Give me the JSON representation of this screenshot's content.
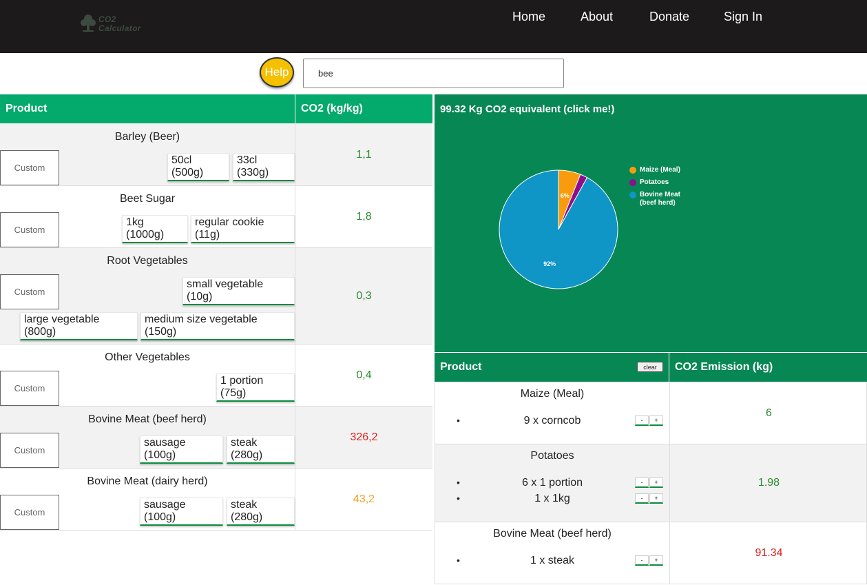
{
  "nav": {
    "logo_line1": "CO2",
    "logo_line2": "Calculator",
    "items": [
      "Home",
      "About",
      "Donate",
      "Sign In"
    ]
  },
  "help_label": "Help",
  "search": {
    "value": "bee"
  },
  "left_table": {
    "headers": {
      "product": "Product",
      "co2": "CO2 (kg/kg)"
    },
    "custom_placeholder": "Custom",
    "rows": [
      {
        "name": "Barley (Beer)",
        "co2": "1,1",
        "co2_color": "#2a8a2a",
        "buttons": [
          "50cl (500g)",
          "33cl (330g)"
        ]
      },
      {
        "name": "Beet Sugar",
        "co2": "1,8",
        "co2_color": "#2a8a2a",
        "buttons": [
          "1kg (1000g)",
          "regular cookie (11g)"
        ]
      },
      {
        "name": "Root Vegetables",
        "co2": "0,3",
        "co2_color": "#2a8a2a",
        "buttons": [
          "small vegetable (10g)",
          "large vegetable (800g)",
          "medium size vegetable (150g)"
        ]
      },
      {
        "name": "Other Vegetables",
        "co2": "0,4",
        "co2_color": "#2a8a2a",
        "buttons": [
          "1 portion (75g)"
        ]
      },
      {
        "name": "Bovine Meat (beef herd)",
        "co2": "326,2",
        "co2_color": "#e02020",
        "buttons": [
          "sausage (100g)",
          "steak (280g)"
        ]
      },
      {
        "name": "Bovine Meat (dairy herd)",
        "co2": "43,2",
        "co2_color": "#f0a020",
        "buttons": [
          "sausage (100g)",
          "steak (280g)"
        ]
      }
    ]
  },
  "chart": {
    "title": "99.32 Kg CO2 equivalent (click me!)"
  },
  "chart_data": {
    "type": "pie",
    "title": "",
    "legend_position": "right",
    "slices": [
      {
        "label": "Maize (Meal)",
        "value": 6,
        "color": "#f89c0e",
        "pct_label": "6%"
      },
      {
        "label": "Potatoes",
        "value": 1.98,
        "color": "#8e0e8e",
        "pct_label": ""
      },
      {
        "label": "Bovine Meat (beef herd)",
        "value": 91.34,
        "color": "#0f96c6",
        "pct_label": "92%"
      }
    ]
  },
  "right_table": {
    "headers": {
      "product": "Product",
      "clear": "clear",
      "emission": "CO2 Emission (kg)"
    },
    "rows": [
      {
        "name": "Maize (Meal)",
        "items": [
          "9 x corncob"
        ],
        "value": "6",
        "color": "#2a8a2a"
      },
      {
        "name": "Potatoes",
        "items": [
          "6 x 1 portion",
          "1 x 1kg"
        ],
        "value": "1.98",
        "color": "#2a8a2a"
      },
      {
        "name": "Bovine Meat (beef herd)",
        "items": [
          "1 x steak"
        ],
        "value": "91.34",
        "color": "#e02020"
      }
    ],
    "minus": "-",
    "plus": "+",
    "bullet": "•"
  }
}
